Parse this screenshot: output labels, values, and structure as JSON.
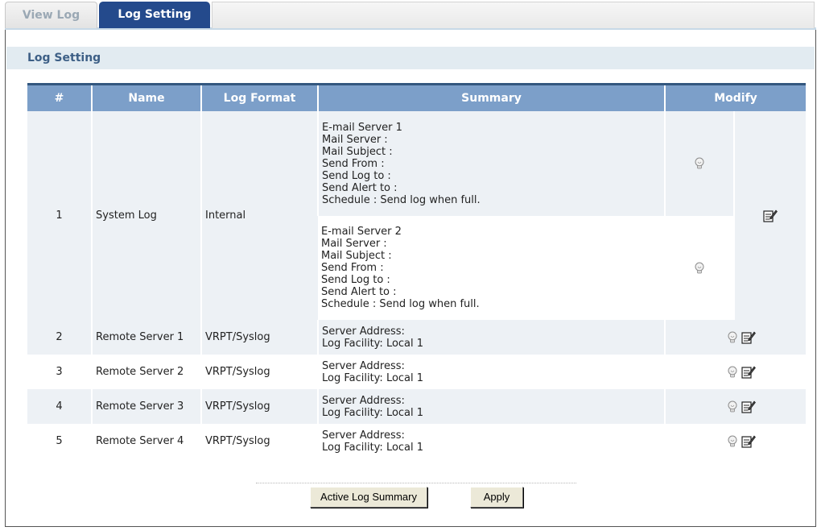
{
  "tabs": [
    {
      "label": "View Log"
    },
    {
      "label": "Log Setting"
    }
  ],
  "section_title": "Log Setting",
  "table": {
    "headers": [
      "#",
      "Name",
      "Log Format",
      "Summary",
      "Modify"
    ],
    "row1": {
      "num": "1",
      "name": "System Log",
      "format": "Internal",
      "summary1": [
        "E-mail Server 1",
        "Mail Server :",
        "Mail Subject :",
        "Send From :",
        "Send Log to :",
        "Send Alert to :",
        "Schedule : Send log when full."
      ],
      "summary2": [
        "E-mail Server 2",
        "Mail Server :",
        "Mail Subject :",
        "Send From :",
        "Send Log to :",
        "Send Alert to :",
        "Schedule : Send log when full."
      ]
    },
    "rows": [
      {
        "num": "2",
        "name": "Remote Server 1",
        "format": "VRPT/Syslog",
        "summary": [
          "Server Address:",
          "Log Facility: Local 1"
        ]
      },
      {
        "num": "3",
        "name": "Remote Server 2",
        "format": "VRPT/Syslog",
        "summary": [
          "Server Address:",
          "Log Facility: Local 1"
        ]
      },
      {
        "num": "4",
        "name": "Remote Server 3",
        "format": "VRPT/Syslog",
        "summary": [
          "Server Address:",
          "Log Facility: Local 1"
        ]
      },
      {
        "num": "5",
        "name": "Remote Server 4",
        "format": "VRPT/Syslog",
        "summary": [
          "Server Address:",
          "Log Facility: Local 1"
        ]
      }
    ]
  },
  "buttons": {
    "active_log_summary": "Active Log Summary",
    "apply": "Apply"
  },
  "icons": {
    "status": "lightbulb-icon",
    "edit": "edit-icon"
  },
  "colors": {
    "active_tab": "#244a8c",
    "header_bg": "#7c9fc9",
    "header_top_border": "#33577f",
    "row_shade": "#edf1f5",
    "section_bg": "#e2ebf1"
  }
}
